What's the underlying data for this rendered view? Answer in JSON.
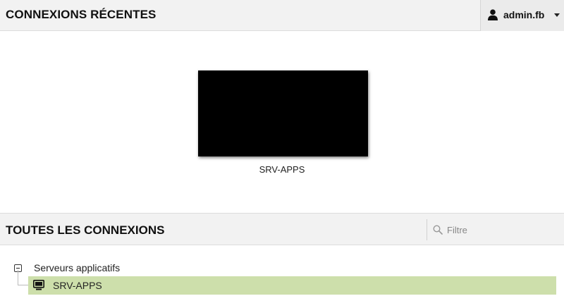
{
  "header": {
    "title": "CONNEXIONS RÉCENTES",
    "user": {
      "name": "admin.fb",
      "icon": "user-icon"
    }
  },
  "recent": {
    "items": [
      {
        "label": "SRV-APPS",
        "thumbnail_color": "#000000"
      }
    ]
  },
  "all_connections": {
    "title": "TOUTES LES CONNEXIONS",
    "filter": {
      "placeholder": "Filtre",
      "value": "",
      "icon": "search-icon"
    },
    "groups": [
      {
        "label": "Serveurs applicatifs",
        "expanded": true,
        "children": [
          {
            "label": "SRV-APPS",
            "icon": "monitor-icon",
            "highlighted": true
          }
        ]
      }
    ]
  },
  "colors": {
    "header_bg": "#f2f2f2",
    "highlight": "#cddfab"
  }
}
